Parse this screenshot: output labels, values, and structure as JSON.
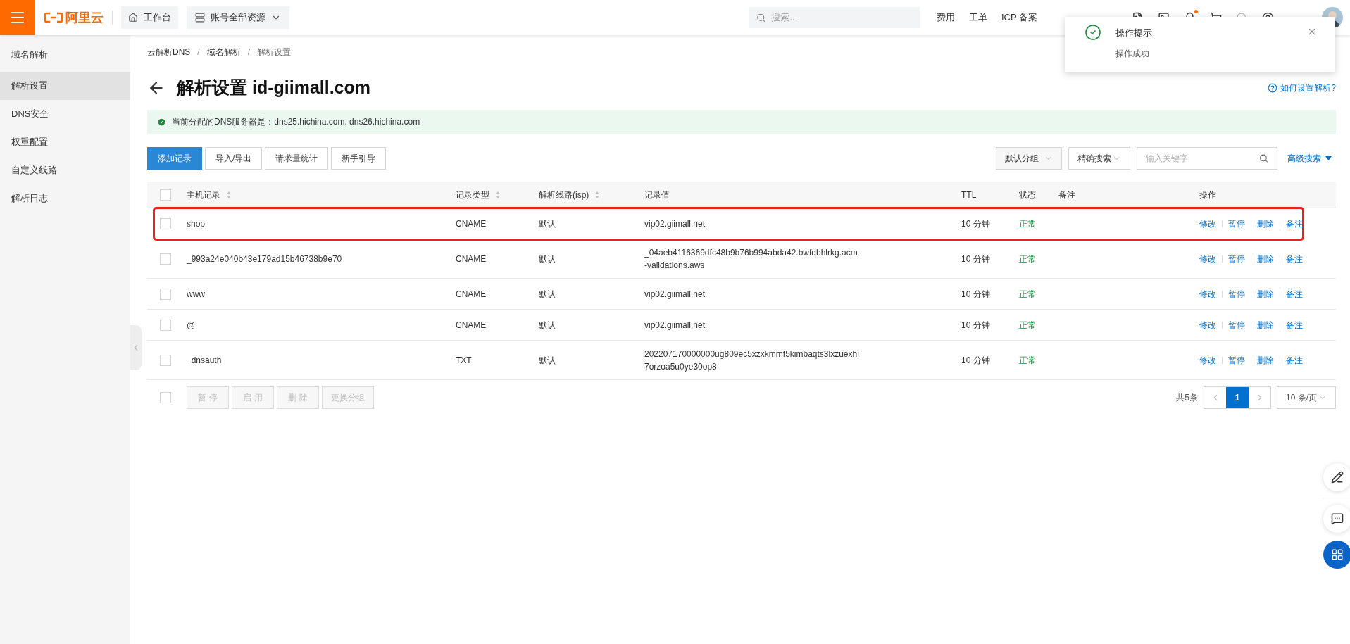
{
  "topbar": {
    "logo_text": "阿里云",
    "workbench": "工作台",
    "resources": "账号全部资源",
    "search_placeholder": "搜索...",
    "nav": [
      "费用",
      "工单",
      "ICP 备案"
    ],
    "notification_dot": true
  },
  "sidebar": {
    "items": [
      {
        "label": "域名解析",
        "selected": false
      },
      {
        "label": "解析设置",
        "selected": true
      },
      {
        "label": "DNS安全",
        "selected": false
      },
      {
        "label": "权重配置",
        "selected": false
      },
      {
        "label": "自定义线路",
        "selected": false
      },
      {
        "label": "解析日志",
        "selected": false
      }
    ]
  },
  "breadcrumb": [
    {
      "kind": "link",
      "text": "云解析DNS"
    },
    {
      "kind": "separator",
      "text": "/"
    },
    {
      "kind": "link",
      "text": "域名解析"
    },
    {
      "kind": "separator",
      "text": "/"
    },
    {
      "kind": "current",
      "text": "解析设置"
    }
  ],
  "title": "解析设置 id-giimall.com",
  "help_link": "如何设置解析?",
  "alert": "当前分配的DNS服务器是：dns25.hichina.com, dns26.hichina.com",
  "toolbar": [
    {
      "label": "添加记录",
      "kind": "primary"
    },
    {
      "label": "导入/导出",
      "kind": "default"
    },
    {
      "label": "请求量统计",
      "kind": "default"
    },
    {
      "label": "新手引导",
      "kind": "default"
    }
  ],
  "filters": {
    "group": "默认分组",
    "search_mode": "精确搜索",
    "keyword_placeholder": "输入关键字",
    "advanced": "高级搜索"
  },
  "table": {
    "columns": [
      {
        "label": "主机记录",
        "sortable": true
      },
      {
        "label": "记录类型",
        "sortable": true
      },
      {
        "label": "解析线路(isp)",
        "sortable": true
      },
      {
        "label": "记录值",
        "sortable": false
      },
      {
        "label": "TTL",
        "sortable": false
      },
      {
        "label": "状态",
        "sortable": false
      },
      {
        "label": "备注",
        "sortable": false
      },
      {
        "label": "操作",
        "sortable": false
      }
    ],
    "rows": [
      {
        "checked": false,
        "highlighted": true,
        "host": "shop",
        "type": "CNAME",
        "line": "默认",
        "value": [
          "vip02.giimall.net"
        ],
        "ttl": "10 分钟",
        "status": "正常",
        "actions": [
          "修改",
          "暂停",
          "删除",
          "备注"
        ]
      },
      {
        "checked": false,
        "highlighted": false,
        "host": "_993a24e040b43e179ad15b46738b9e70",
        "type": "CNAME",
        "line": "默认",
        "value": [
          "_04aeb4116369dfc48b9b76b994abda42.bwfqbhlrkg.acm",
          "-validations.aws"
        ],
        "ttl": "10 分钟",
        "status": "正常",
        "actions": [
          "修改",
          "暂停",
          "删除",
          "备注"
        ]
      },
      {
        "checked": false,
        "highlighted": false,
        "host": "www",
        "type": "CNAME",
        "line": "默认",
        "value": [
          "vip02.giimall.net"
        ],
        "ttl": "10 分钟",
        "status": "正常",
        "actions": [
          "修改",
          "暂停",
          "删除",
          "备注"
        ]
      },
      {
        "checked": false,
        "highlighted": false,
        "host": "@",
        "type": "CNAME",
        "line": "默认",
        "value": [
          "vip02.giimall.net"
        ],
        "ttl": "10 分钟",
        "status": "正常",
        "actions": [
          "修改",
          "暂停",
          "删除",
          "备注"
        ]
      },
      {
        "checked": false,
        "highlighted": false,
        "host": "_dnsauth",
        "type": "TXT",
        "line": "默认",
        "value": [
          "202207170000000ug809ec5xzxkmmf5kimbaqts3lxzuexhi",
          "7orzoa5u0ye30op8"
        ],
        "ttl": "10 分钟",
        "status": "正常",
        "actions": [
          "修改",
          "暂停",
          "删除",
          "备注"
        ]
      }
    ]
  },
  "bulk": {
    "checked": false,
    "disabled": true,
    "actions": [
      "暂 停",
      "启 用",
      "删 除",
      "更换分组"
    ]
  },
  "pagination": {
    "total": "共5条",
    "pages": [
      {
        "label": "1",
        "selected": true
      }
    ],
    "page_size": "10 条/页"
  },
  "toast": {
    "title": "操作提示",
    "message": "操作成功"
  }
}
